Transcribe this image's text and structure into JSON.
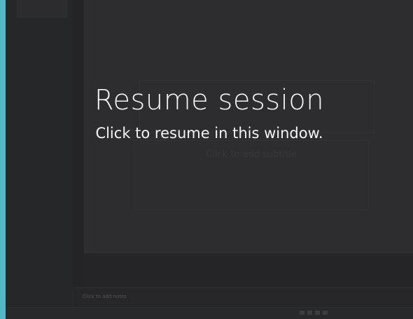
{
  "editor": {
    "subtitle_placeholder": "Click to add subtitle",
    "notes_placeholder": "Click to add notes"
  },
  "overlay": {
    "title": "Resume session",
    "subtitle": "Click to resume in this window."
  },
  "colors": {
    "frame": "#56b6c6",
    "background": "#2b2b2c",
    "slide": "#363637",
    "overlay_text": "#f2f2f2"
  }
}
